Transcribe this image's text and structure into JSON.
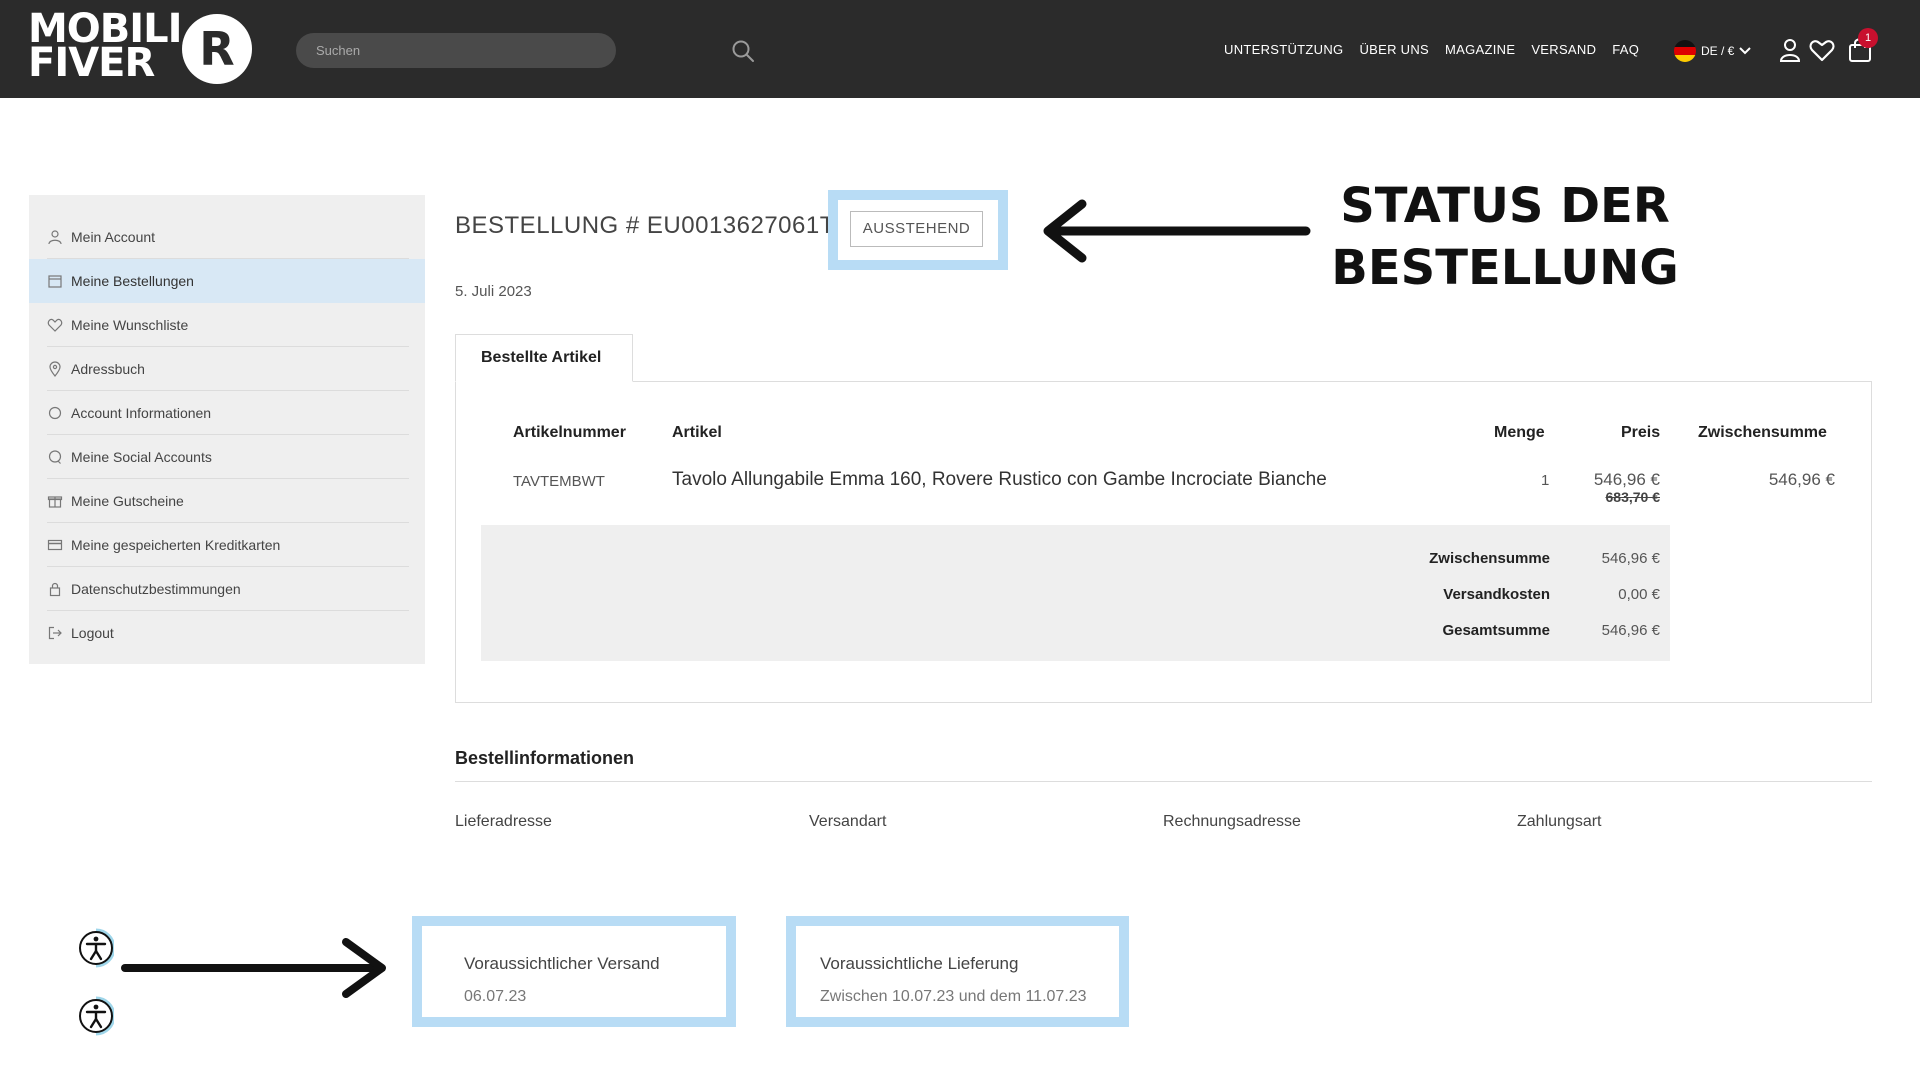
{
  "header": {
    "logo": {
      "line1": "MOBILI",
      "line2": "FIVER",
      "mark": "R"
    },
    "search_placeholder": "Suchen",
    "nav": [
      "UNTERSTÜTZUNG",
      "ÜBER UNS",
      "MAGAZINE",
      "VERSAND",
      "FAQ"
    ],
    "lang_label": "DE / €",
    "cart_count": "1"
  },
  "sidebar": {
    "items": [
      {
        "label": "Mein Account",
        "icon": "user-icon"
      },
      {
        "label": "Meine Bestellungen",
        "icon": "calendar-icon",
        "active": true
      },
      {
        "label": "Meine Wunschliste",
        "icon": "heart-icon"
      },
      {
        "label": "Adressbuch",
        "icon": "map-pin-icon"
      },
      {
        "label": "Account Informationen",
        "icon": "circle-icon"
      },
      {
        "label": "Meine Social Accounts",
        "icon": "chat-icon"
      },
      {
        "label": "Meine Gutscheine",
        "icon": "gift-icon"
      },
      {
        "label": "Meine gespeicherten Kreditkarten",
        "icon": "credit-card-icon"
      },
      {
        "label": "Datenschutzbestimmungen",
        "icon": "lock-icon"
      },
      {
        "label": "Logout",
        "icon": "logout-icon"
      }
    ]
  },
  "order": {
    "title": "BESTELLUNG # EU0013627061T",
    "status": "AUSSTEHEND",
    "date": "5. Juli 2023"
  },
  "annotation": {
    "status_text": "STATUS DER BESTELLUNG"
  },
  "items_tab": {
    "label": "Bestellte Artikel"
  },
  "table": {
    "headers": {
      "sku": "Artikelnummer",
      "item": "Artikel",
      "qty": "Menge",
      "price": "Preis",
      "subtotal": "Zwischensumme"
    },
    "rows": [
      {
        "sku": "TAVTEMBWT",
        "item": "Tavolo Allungabile Emma 160, Rovere Rustico con Gambe Incrociate Bianche",
        "qty": "1",
        "price": "546,96 €",
        "old_price": "683,70 €",
        "subtotal": "546,96 €"
      }
    ]
  },
  "totals": {
    "subtotal_label": "Zwischensumme",
    "subtotal_value": "546,96 €",
    "shipping_label": "Versandkosten",
    "shipping_value": "0,00 €",
    "total_label": "Gesamtsumme",
    "total_value": "546,96 €"
  },
  "info": {
    "title": "Bestellinformationen",
    "cols": [
      "Lieferadresse",
      "Versandart",
      "Rechnungsadresse",
      "Zahlungsart"
    ]
  },
  "shipping": {
    "expected_ship_label": "Voraussichtlicher Versand",
    "expected_ship_value": "06.07.23",
    "expected_delivery_label": "Voraussichtliche Lieferung",
    "expected_delivery_value": "Zwischen 10.07.23 und dem 11.07.23"
  },
  "colors": {
    "header_bg": "#2b2b2b",
    "highlight": "#b8dcf5",
    "active_item": "#d8e8f5",
    "badge": "#c8102e"
  }
}
